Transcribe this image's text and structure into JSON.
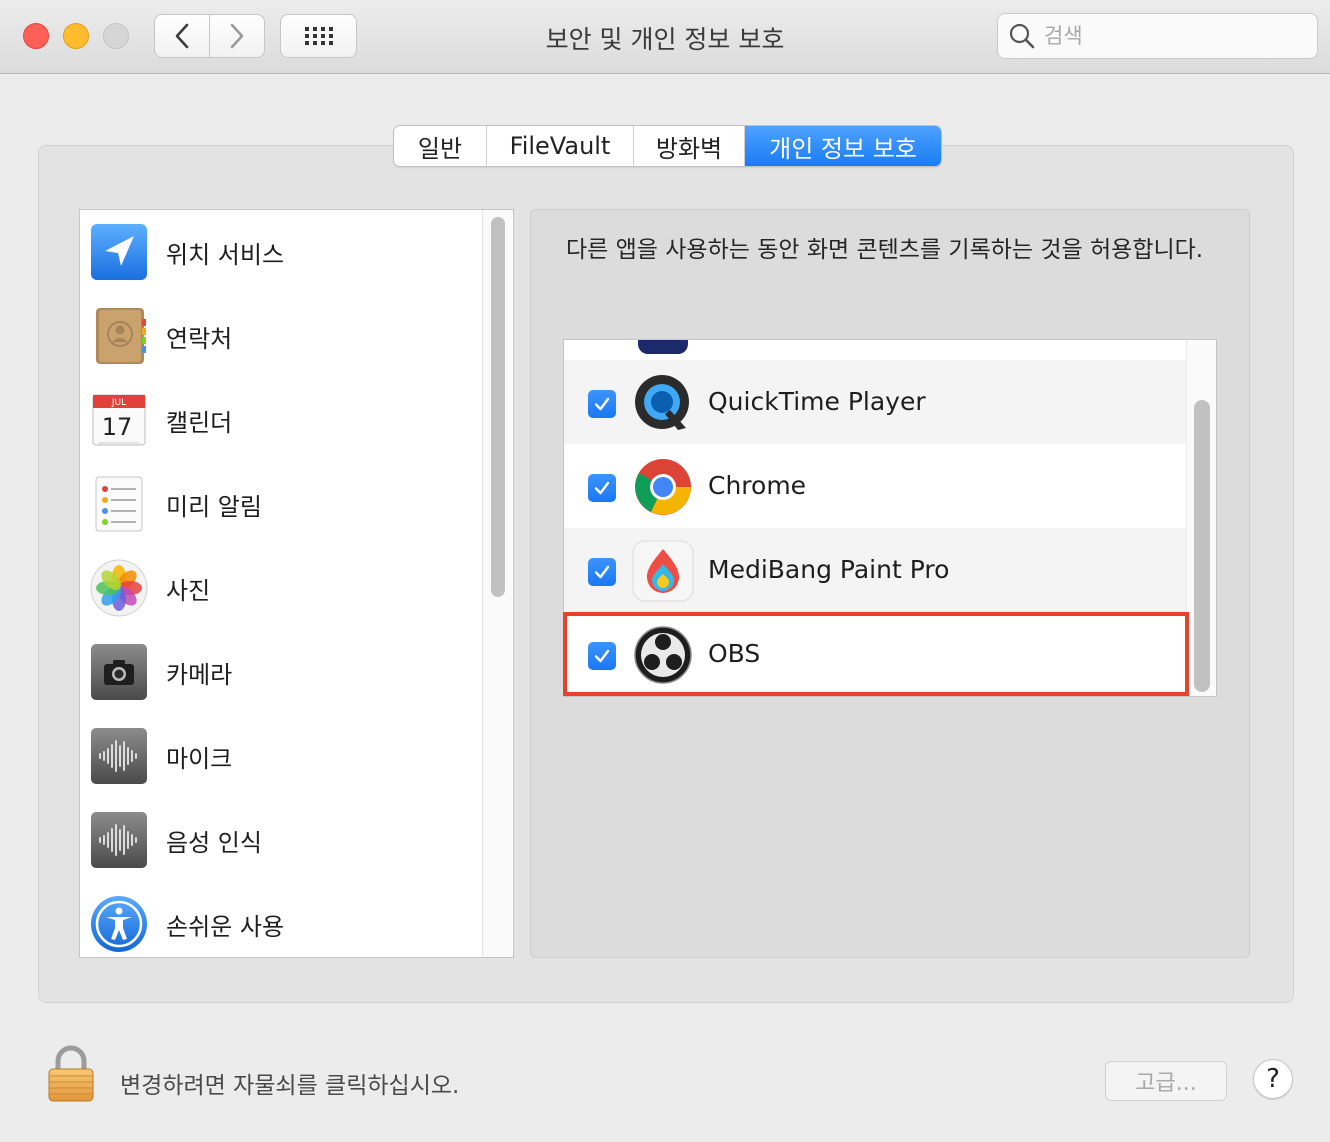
{
  "window": {
    "title": "보안 및 개인 정보 보호",
    "search_placeholder": "검색"
  },
  "tabs": [
    {
      "label": "일반",
      "active": false
    },
    {
      "label": "FileVault",
      "active": false
    },
    {
      "label": "방화벽",
      "active": false
    },
    {
      "label": "개인 정보 보호",
      "active": true
    }
  ],
  "sidebar": {
    "items": [
      {
        "label": "위치 서비스",
        "icon": "location-icon"
      },
      {
        "label": "연락처",
        "icon": "contacts-icon"
      },
      {
        "label": "캘린더",
        "icon": "calendar-icon",
        "calendar_month": "JUL",
        "calendar_day": "17"
      },
      {
        "label": "미리 알림",
        "icon": "reminders-icon"
      },
      {
        "label": "사진",
        "icon": "photos-icon"
      },
      {
        "label": "카메라",
        "icon": "camera-icon"
      },
      {
        "label": "마이크",
        "icon": "microphone-icon"
      },
      {
        "label": "음성 인식",
        "icon": "speech-recognition-icon"
      },
      {
        "label": "손쉬운 사용",
        "icon": "accessibility-icon"
      }
    ]
  },
  "main": {
    "description": "다른 앱을 사용하는 동안 화면 콘텐츠를 기록하는 것을 허용합니다.",
    "apps": [
      {
        "name": "QuickTime Player",
        "checked": true,
        "icon": "quicktime-icon"
      },
      {
        "name": "Chrome",
        "checked": true,
        "icon": "chrome-icon"
      },
      {
        "name": "MediBang Paint Pro",
        "checked": true,
        "icon": "medibang-icon"
      },
      {
        "name": "OBS",
        "checked": true,
        "icon": "obs-icon"
      }
    ],
    "highlight_color": "#e8412c"
  },
  "footer": {
    "lock_text": "변경하려면 자물쇠를 클릭하십시오.",
    "advanced_label": "고급...",
    "help_label": "?"
  },
  "colors": {
    "accent": "#1a7cf5"
  }
}
